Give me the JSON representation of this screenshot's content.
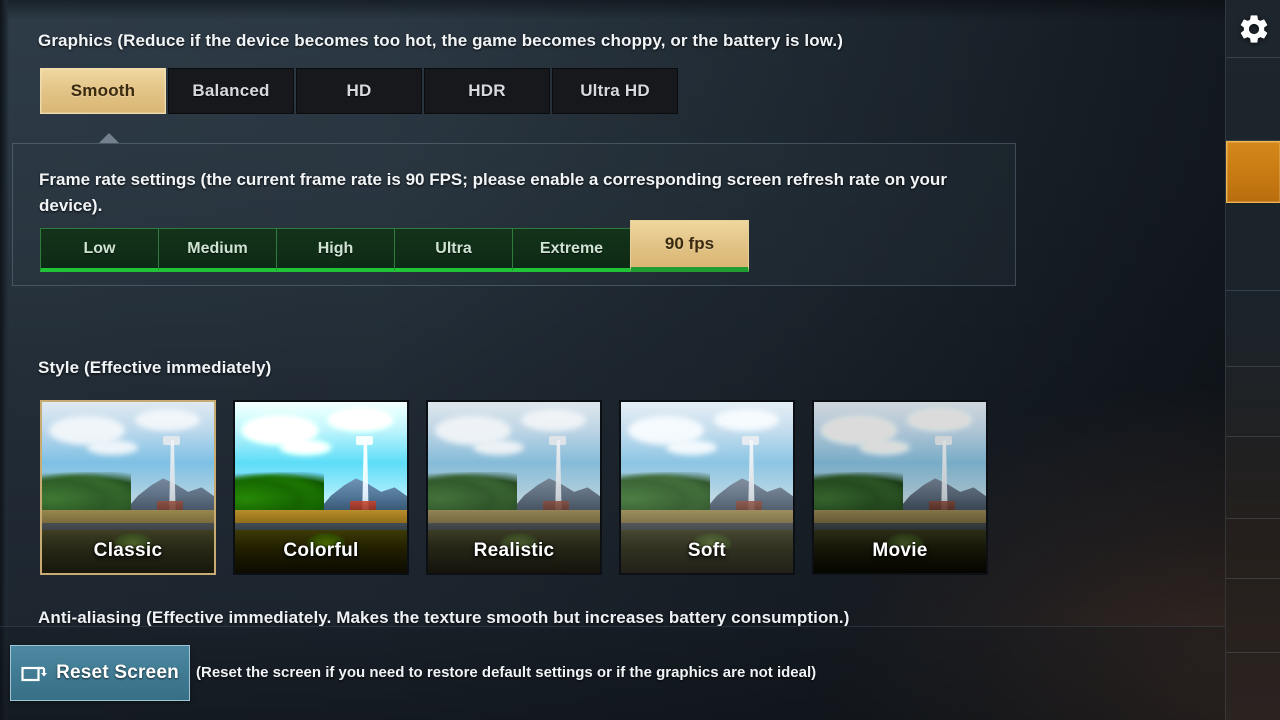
{
  "graphics": {
    "label": "Graphics (Reduce if the device becomes too hot, the game becomes choppy, or the battery is low.)",
    "options": [
      {
        "label": "Smooth",
        "selected": true
      },
      {
        "label": "Balanced",
        "selected": false
      },
      {
        "label": "HD",
        "selected": false
      },
      {
        "label": "HDR",
        "selected": false
      },
      {
        "label": "Ultra HD",
        "selected": false
      }
    ]
  },
  "frame_rate": {
    "description": "Frame rate settings (the current frame rate is 90 FPS; please enable a corresponding screen refresh rate on your device).",
    "current_fps": "90 FPS",
    "options": [
      {
        "label": "Low",
        "selected": false
      },
      {
        "label": "Medium",
        "selected": false
      },
      {
        "label": "High",
        "selected": false
      },
      {
        "label": "Ultra",
        "selected": false
      },
      {
        "label": "Extreme",
        "selected": false
      },
      {
        "label": "90 fps",
        "selected": true
      }
    ]
  },
  "style": {
    "label": "Style (Effective immediately)",
    "options": [
      {
        "label": "Classic",
        "selected": true,
        "grade": "grade-classic"
      },
      {
        "label": "Colorful",
        "selected": false,
        "grade": "grade-colorful"
      },
      {
        "label": "Realistic",
        "selected": false,
        "grade": "grade-realistic"
      },
      {
        "label": "Soft",
        "selected": false,
        "grade": "grade-soft"
      },
      {
        "label": "Movie",
        "selected": false,
        "grade": "grade-movie"
      }
    ]
  },
  "anti_aliasing": {
    "label": "Anti-aliasing (Effective immediately. Makes the texture smooth but increases battery consumption.)"
  },
  "bottom_bar": {
    "reset_label": "Reset Screen",
    "reset_icon": "reset-screen-icon",
    "reset_hint": "(Reset the screen if you need to restore default settings or if the graphics are not ideal)"
  },
  "sidebar": {
    "gear_icon": "gear-icon",
    "items": [
      {
        "active": false
      },
      {
        "active": true
      },
      {
        "active": false
      },
      {
        "active": false
      },
      {
        "active": false
      },
      {
        "active": false
      },
      {
        "active": false
      },
      {
        "active": false
      }
    ]
  },
  "colors": {
    "selected_gold": "#e3c488",
    "fps_green": "#21c437",
    "fps_fill": "#12331a",
    "teal_button": "#3f7a92",
    "sidebar_active_orange": "#c87a12",
    "panel_bg": "#2b3843",
    "text_primary": "#f2f5f7"
  }
}
